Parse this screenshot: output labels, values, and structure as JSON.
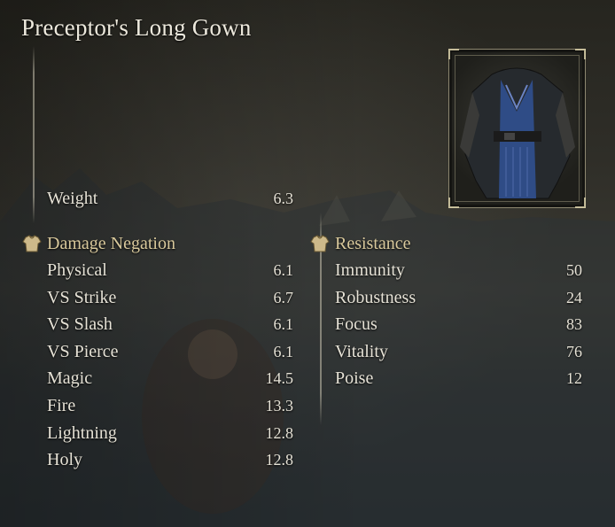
{
  "title": "Preceptor's Long Gown",
  "weight": {
    "label": "Weight",
    "value": "6.3"
  },
  "damage_negation": {
    "heading": "Damage Negation",
    "icon": "chest-armor-icon",
    "rows": [
      {
        "label": "Physical",
        "value": "6.1"
      },
      {
        "label": "VS Strike",
        "value": "6.7"
      },
      {
        "label": "VS Slash",
        "value": "6.1"
      },
      {
        "label": "VS Pierce",
        "value": "6.1"
      },
      {
        "label": "Magic",
        "value": "14.5"
      },
      {
        "label": "Fire",
        "value": "13.3"
      },
      {
        "label": "Lightning",
        "value": "12.8"
      },
      {
        "label": "Holy",
        "value": "12.8"
      }
    ]
  },
  "resistance": {
    "heading": "Resistance",
    "icon": "chest-armor-icon",
    "rows": [
      {
        "label": "Immunity",
        "value": "50"
      },
      {
        "label": "Robustness",
        "value": "24"
      },
      {
        "label": "Focus",
        "value": "83"
      },
      {
        "label": "Vitality",
        "value": "76"
      },
      {
        "label": "Poise",
        "value": "12"
      }
    ]
  },
  "colors": {
    "accent": "#d9c99c",
    "text": "#e6e2d6",
    "frame": "#d7cdaa"
  }
}
